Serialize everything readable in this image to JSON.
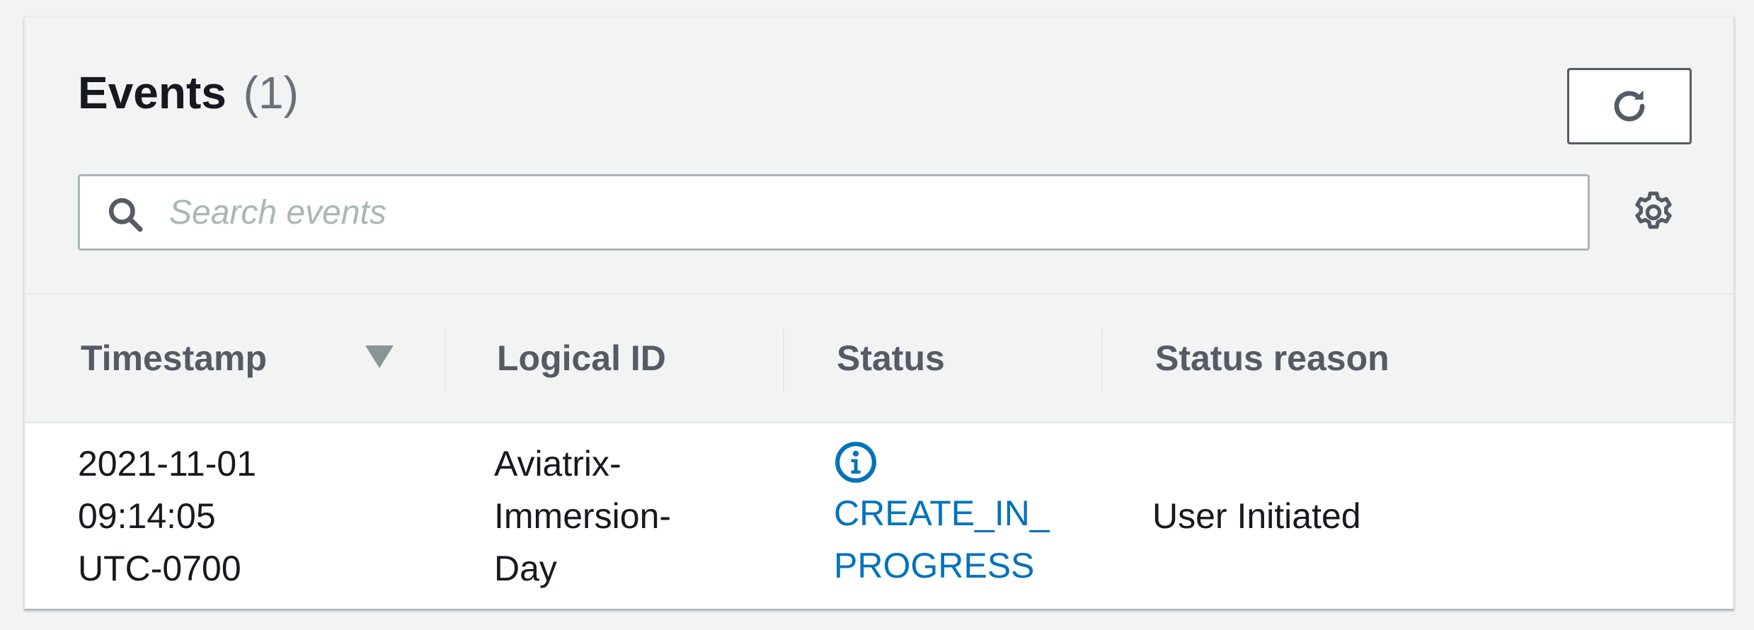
{
  "header": {
    "title": "Events",
    "count": "(1)"
  },
  "search": {
    "placeholder": "Search events",
    "value": ""
  },
  "icons": {
    "refresh": "refresh-icon",
    "search": "search-icon",
    "settings": "gear-icon",
    "sort": "sort-descending-icon",
    "status": "info-icon"
  },
  "table": {
    "columns": [
      "Timestamp",
      "Logical ID",
      "Status",
      "Status reason"
    ],
    "rows": [
      {
        "timestamp": [
          "2021-11-01",
          "09:14:05",
          "UTC-0700"
        ],
        "logical_id": [
          "Aviatrix-",
          "Immersion-",
          "Day"
        ],
        "status": [
          "CREATE_IN_",
          "PROGRESS"
        ],
        "status_reason": "User Initiated"
      }
    ]
  },
  "colors": {
    "link": "#0073bb",
    "text": "#16191f",
    "header_text": "#545b64",
    "background": "#f2f3f3"
  }
}
